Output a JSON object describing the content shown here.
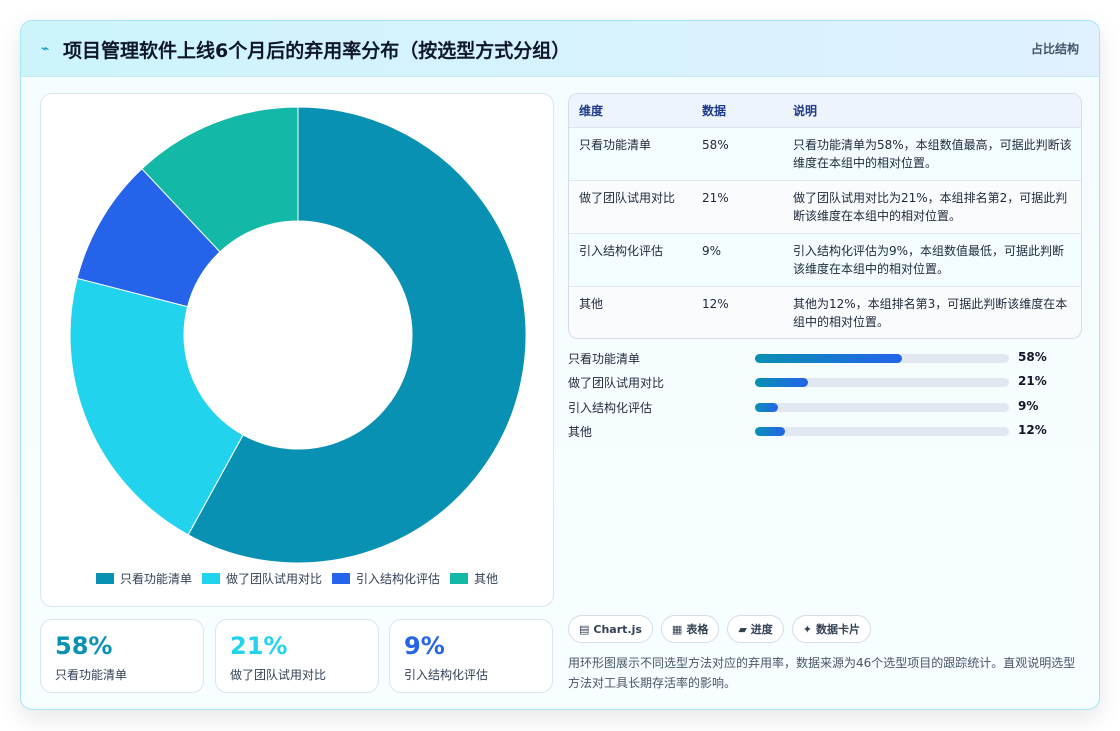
{
  "header": {
    "icon": "wave-icon",
    "title": "项目管理软件上线6个月后的弃用率分布（按选型方式分组）",
    "tag": "占比结构"
  },
  "chart_data": {
    "type": "pie",
    "donut": true,
    "categories": [
      "只看功能清单",
      "做了团队试用对比",
      "引入结构化评估",
      "其他"
    ],
    "values": [
      58,
      21,
      9,
      12
    ],
    "unit": "%",
    "colors": [
      "#0891b2",
      "#22d3ee",
      "#2563eb",
      "#14b8a6"
    ],
    "legend_position": "bottom"
  },
  "stats": [
    {
      "value": "58%",
      "label": "只看功能清单",
      "color": "#0891b2"
    },
    {
      "value": "21%",
      "label": "做了团队试用对比",
      "color": "#22d3ee"
    },
    {
      "value": "9%",
      "label": "引入结构化评估",
      "color": "#2563eb"
    }
  ],
  "table": {
    "headers": [
      "维度",
      "数据",
      "说明"
    ],
    "rows": [
      {
        "dim": "只看功能清单",
        "data": "58%",
        "desc": "只看功能清单为58%，本组数值最高，可据此判断该维度在本组中的相对位置。"
      },
      {
        "dim": "做了团队试用对比",
        "data": "21%",
        "desc": "做了团队试用对比为21%，本组排名第2，可据此判断该维度在本组中的相对位置。"
      },
      {
        "dim": "引入结构化评估",
        "data": "9%",
        "desc": "引入结构化评估为9%，本组数值最低，可据此判断该维度在本组中的相对位置。"
      },
      {
        "dim": "其他",
        "data": "12%",
        "desc": "其他为12%，本组排名第3，可据此判断该维度在本组中的相对位置。"
      }
    ]
  },
  "progress": [
    {
      "label": "只看功能清单",
      "value": 58,
      "text": "58%"
    },
    {
      "label": "做了团队试用对比",
      "value": 21,
      "text": "21%"
    },
    {
      "label": "引入结构化评估",
      "value": 9,
      "text": "9%"
    },
    {
      "label": "其他",
      "value": 12,
      "text": "12%"
    }
  ],
  "chips": [
    {
      "icon": "▤",
      "label": "Chart.js"
    },
    {
      "icon": "▦",
      "label": "表格"
    },
    {
      "icon": "▰",
      "label": "进度"
    },
    {
      "icon": "✦",
      "label": "数据卡片"
    }
  ],
  "note": "用环形图展示不同选型方法对应的弃用率，数据来源为46个选型项目的跟踪统计。直观说明选型方法对工具长期存活率的影响。"
}
